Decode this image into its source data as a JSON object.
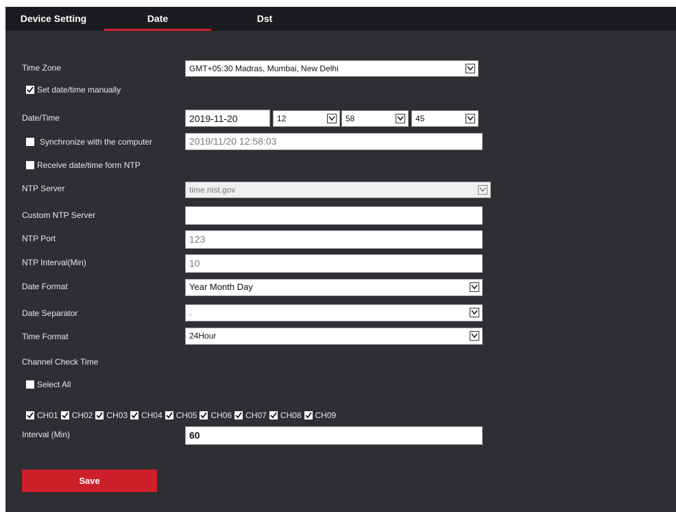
{
  "tabs": {
    "device_setting": "Device Setting",
    "date": "Date",
    "dst": "Dst"
  },
  "labels": {
    "time_zone": "Time Zone",
    "set_manually": "Set date/time manually",
    "date_time": "Date/Time",
    "sync_computer": "Synchronize with the computer",
    "receive_ntp": "Receive date/time form NTP",
    "ntp_server": "NTP Server",
    "custom_ntp_server": "Custom NTP Server",
    "ntp_port": "NTP Port",
    "ntp_interval": "NTP Interval(Min)",
    "date_format": "Date Format",
    "date_separator": "Date Separator",
    "time_format": "Time Format",
    "channel_check_time": "Channel Check Time",
    "select_all": "Select All",
    "interval_min": "Interval (Min)"
  },
  "values": {
    "time_zone": "GMT+05:30 Madras, Mumbai, New Delhi",
    "date": "2019-11-20",
    "hour": "12",
    "minute": "58",
    "second": "45",
    "computer_time": "2019/11/20 12:58:03",
    "ntp_server": "time.nist.gov",
    "custom_ntp_server": "",
    "ntp_port": "123",
    "ntp_interval": "10",
    "date_format": "Year Month Day",
    "date_separator": ".",
    "time_format": "24Hour",
    "interval_min": "60"
  },
  "checks": {
    "set_manually": true,
    "sync_computer": false,
    "receive_ntp": false,
    "select_all": false
  },
  "channels": [
    {
      "label": "CH01",
      "checked": true
    },
    {
      "label": "CH02",
      "checked": true
    },
    {
      "label": "CH03",
      "checked": true
    },
    {
      "label": "CH04",
      "checked": true
    },
    {
      "label": "CH05",
      "checked": true
    },
    {
      "label": "CH06",
      "checked": true
    },
    {
      "label": "CH07",
      "checked": true
    },
    {
      "label": "CH08",
      "checked": true
    },
    {
      "label": "CH09",
      "checked": true
    }
  ],
  "buttons": {
    "save": "Save"
  },
  "colors": {
    "accent": "#cc1f2a",
    "panel": "#2d2f33",
    "tabbar": "#1a1b1e"
  }
}
